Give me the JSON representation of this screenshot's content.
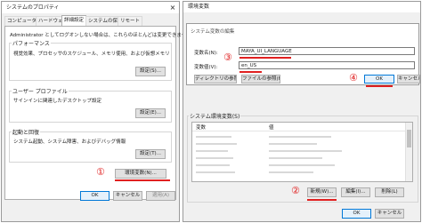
{
  "left": {
    "title": "システムのプロパティ",
    "tabs": [
      "コンピューター名",
      "ハードウェア",
      "詳細設定",
      "システムの保護",
      "リモート"
    ],
    "admin_note": "Administrator としてログオンしない場合は、これらのほとんどは変更できません。",
    "performance": {
      "label": "パフォーマンス",
      "desc": "視覚効果、プロセッサのスケジュール、メモリ使用、および仮想メモリ",
      "button": "設定(S)..."
    },
    "user_profile": {
      "label": "ユーザー プロファイル",
      "desc": "サインインに関連したデスクトップ設定",
      "button": "設定(E)..."
    },
    "startup": {
      "label": "起動と回復",
      "desc": "システム起動、システム障害、およびデバッグ情報",
      "button": "設定(T)..."
    },
    "env_button": "環境変数(N)...",
    "ok": "OK",
    "cancel": "キャンセル",
    "apply": "適用(A)"
  },
  "right": {
    "title": "環境変数",
    "dialog_title": "システム変数の編集",
    "name_label": "変数名(N):",
    "name_value": "MAYA_UI_LANGUAGE",
    "value_label": "変数値(V):",
    "value_value": "en_US",
    "browse_dir": "ディレクトリの参照(D)...",
    "browse_file": "ファイルの参照(F)...",
    "dialog_ok": "OK",
    "dialog_cancel": "キャンセル",
    "sysvars_label": "システム環境変数(S)",
    "col_var": "変数",
    "col_val": "値",
    "new_btn": "新規(W)...",
    "edit_btn": "編集(I)...",
    "delete_btn": "削除(L)",
    "ok": "OK",
    "cancel": "キャンセル"
  },
  "annotations": {
    "one": "①",
    "two": "②",
    "three": "③",
    "four": "④"
  },
  "colors": {
    "annotation": "#e02020",
    "focus": "#0078d7"
  }
}
